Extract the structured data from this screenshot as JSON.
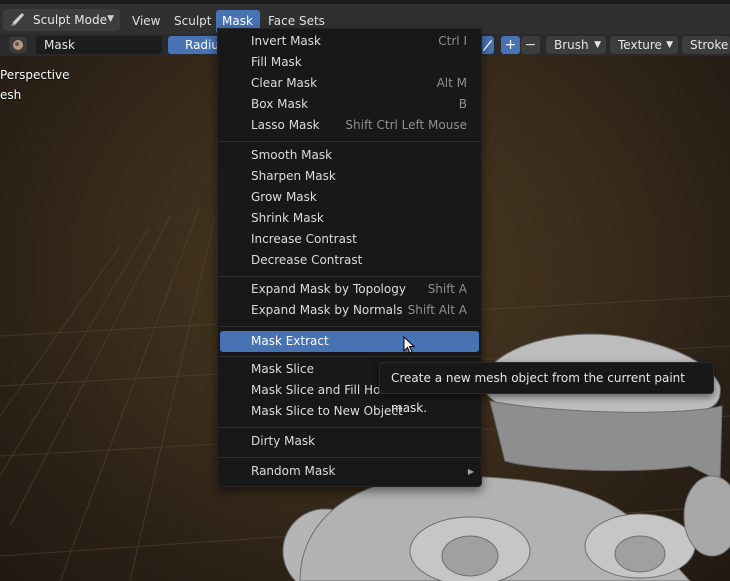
{
  "header": {
    "mode_label": "Sculpt Mode",
    "menus": [
      "View",
      "Sculpt",
      "Mask",
      "Face Sets"
    ]
  },
  "toolbar": {
    "brush_name": "Mask",
    "radius_label": "Radiu",
    "plus": "+",
    "minus": "−",
    "brush_dropdown": "Brush",
    "texture_dropdown": "Texture",
    "stroke_dropdown": "Stroke"
  },
  "viewport": {
    "perspective_label": "Perspective",
    "object_label": "esh"
  },
  "mask_menu": {
    "groups": [
      [
        {
          "label": "Invert Mask",
          "shortcut": "Ctrl I"
        },
        {
          "label": "Fill Mask",
          "shortcut": ""
        },
        {
          "label": "Clear Mask",
          "shortcut": "Alt M"
        },
        {
          "label": "Box Mask",
          "shortcut": "B"
        },
        {
          "label": "Lasso Mask",
          "shortcut": "Shift Ctrl Left Mouse"
        }
      ],
      [
        {
          "label": "Smooth Mask",
          "shortcut": ""
        },
        {
          "label": "Sharpen Mask",
          "shortcut": ""
        },
        {
          "label": "Grow Mask",
          "shortcut": ""
        },
        {
          "label": "Shrink Mask",
          "shortcut": ""
        },
        {
          "label": "Increase Contrast",
          "shortcut": ""
        },
        {
          "label": "Decrease Contrast",
          "shortcut": ""
        }
      ],
      [
        {
          "label": "Expand Mask by Topology",
          "shortcut": "Shift A"
        },
        {
          "label": "Expand Mask by Normals",
          "shortcut": "Shift Alt A"
        }
      ],
      [
        {
          "label": "Mask Extract",
          "shortcut": "",
          "highlighted": true
        }
      ],
      [
        {
          "label": "Mask Slice",
          "shortcut": ""
        },
        {
          "label": "Mask Slice and Fill Holes",
          "shortcut": ""
        },
        {
          "label": "Mask Slice to New Object",
          "shortcut": ""
        }
      ],
      [
        {
          "label": "Dirty Mask",
          "shortcut": ""
        }
      ],
      [
        {
          "label": "Random Mask",
          "shortcut": "",
          "submenu": true
        }
      ]
    ]
  },
  "tooltip": {
    "text": "Create a new mesh object from the current paint mask."
  },
  "colors": {
    "accent": "#4772b3",
    "menu_bg": "#181818",
    "header_bg": "#303030"
  }
}
